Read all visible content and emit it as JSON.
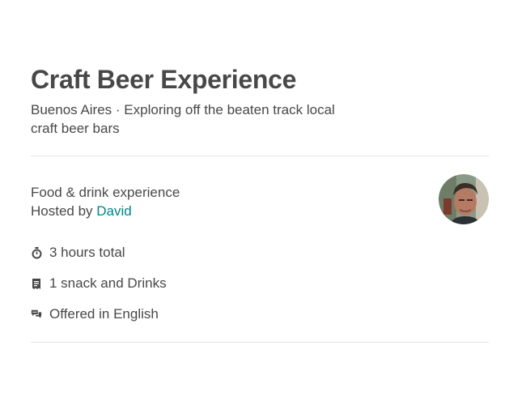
{
  "experience": {
    "title": "Craft Beer Experience",
    "city": "Buenos Aires",
    "separator": " · ",
    "tagline": "Exploring off the beaten track local craft beer bars"
  },
  "host": {
    "category": "Food & drink experience",
    "hosted_by_label": "Hosted by ",
    "host_name": "David",
    "avatar_icon": "host-avatar"
  },
  "details": [
    {
      "icon": "timer-icon",
      "label": "3 hours total"
    },
    {
      "icon": "receipt-icon",
      "label": "1 snack and Drinks"
    },
    {
      "icon": "chat-bubbles-icon",
      "label": "Offered in English"
    }
  ],
  "colors": {
    "text": "#484848",
    "link": "#008489",
    "divider": "#e4e4e4"
  }
}
